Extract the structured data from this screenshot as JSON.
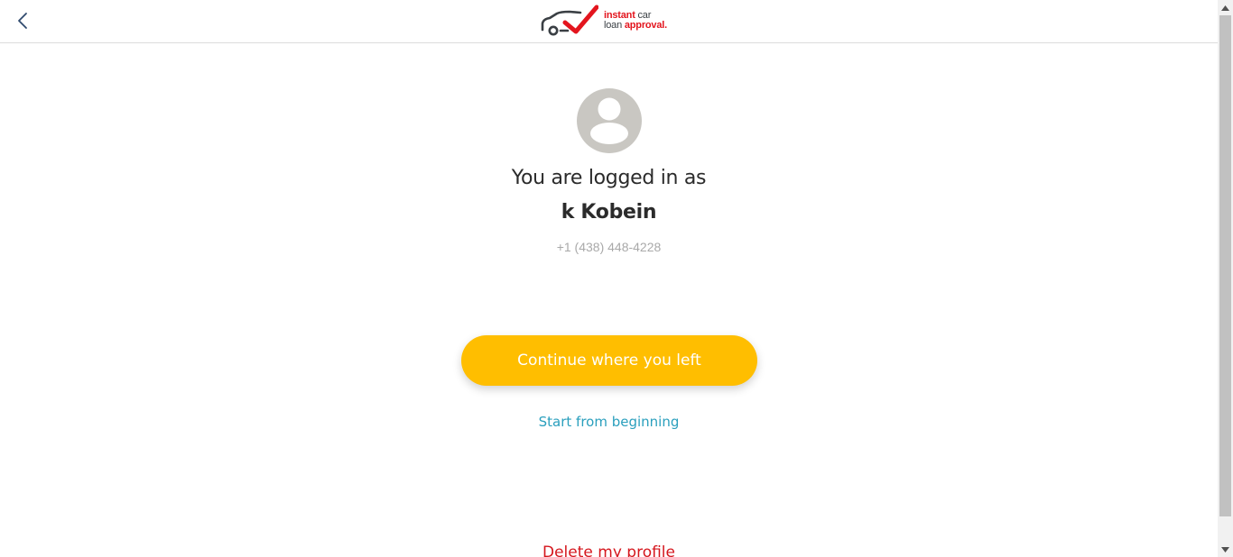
{
  "header": {
    "back_icon": "chevron-left-icon",
    "logo": {
      "icon": "car-checkmark-icon",
      "line1_red": "instant",
      "line1_gray": " car",
      "line2_gray": "loan ",
      "line2_red": "approval."
    }
  },
  "profile": {
    "avatar_icon": "user-avatar-icon",
    "title_line1": "You are logged in as",
    "title_line2": "k Kobein",
    "phone": "+1 (438) 448-4228"
  },
  "actions": {
    "continue_label": "Continue where you left",
    "start_label": "Start from beginning",
    "delete_label": "Delete my profile"
  },
  "colors": {
    "accent_button": "#ffbe00",
    "link": "#2a9fbd",
    "danger": "#d5161d",
    "brand_red": "#e3151e",
    "avatar_bg": "#c9c7c2"
  }
}
